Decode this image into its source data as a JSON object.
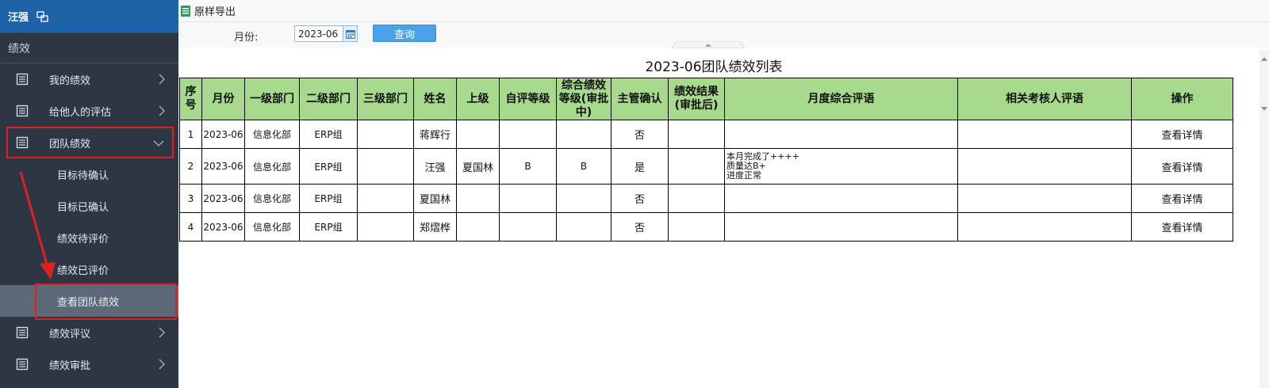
{
  "sidebar": {
    "user_name": "汪强",
    "section_title": "绩效",
    "menu": [
      {
        "label": "我的绩效"
      },
      {
        "label": "给他人的评估"
      },
      {
        "label": "团队绩效"
      },
      {
        "label": "绩效评议"
      },
      {
        "label": "绩效审批"
      }
    ],
    "team_sub": [
      {
        "label": "目标待确认"
      },
      {
        "label": "目标已确认"
      },
      {
        "label": "绩效待评价"
      },
      {
        "label": "绩效已评价"
      },
      {
        "label": "查看团队绩效"
      }
    ]
  },
  "toolbar": {
    "export_label": "原样导出"
  },
  "filter": {
    "month_label": "月份:",
    "month_value": "2023-06",
    "query_label": "查询"
  },
  "report": {
    "title": "2023-06团队绩效列表",
    "headers": [
      "序号",
      "月份",
      "一级部门",
      "二级部门",
      "三级部门",
      "姓名",
      "上级",
      "自评等级",
      "综合绩效等级(审批中)",
      "主管确认",
      "绩效结果(审批后)",
      "月度综合评语",
      "相关考核人评语",
      "操作"
    ],
    "rows": [
      {
        "no": "1",
        "month": "2023-06",
        "dept1": "信息化部",
        "dept2": "ERP组",
        "dept3": "",
        "name": "蒋辉行",
        "superior": "",
        "self_grade": "",
        "comp_grade": "",
        "confirm": "否",
        "result": "",
        "comment": "",
        "related_comment": "",
        "action": "查看详情"
      },
      {
        "no": "2",
        "month": "2023-06",
        "dept1": "信息化部",
        "dept2": "ERP组",
        "dept3": "",
        "name": "汪强",
        "superior": "夏国林",
        "self_grade": "B",
        "comp_grade": "B",
        "confirm": "是",
        "result": "",
        "comment": "本月完成了++++\n质量达B+\n进度正常",
        "related_comment": "",
        "action": "查看详情"
      },
      {
        "no": "3",
        "month": "2023-06",
        "dept1": "信息化部",
        "dept2": "ERP组",
        "dept3": "",
        "name": "夏国林",
        "superior": "",
        "self_grade": "",
        "comp_grade": "",
        "confirm": "否",
        "result": "",
        "comment": "",
        "related_comment": "",
        "action": "查看详情"
      },
      {
        "no": "4",
        "month": "2023-06",
        "dept1": "信息化部",
        "dept2": "ERP组",
        "dept3": "",
        "name": "郑熠桦",
        "superior": "",
        "self_grade": "",
        "comp_grade": "",
        "confirm": "否",
        "result": "",
        "comment": "",
        "related_comment": "",
        "action": "查看详情"
      }
    ]
  },
  "colors": {
    "sidebar_bg": "#2d3643",
    "user_bar": "#1e63a8",
    "header_green": "#a7da8c",
    "highlight_red": "#e02020",
    "query_blue": "#4aa3e8"
  }
}
